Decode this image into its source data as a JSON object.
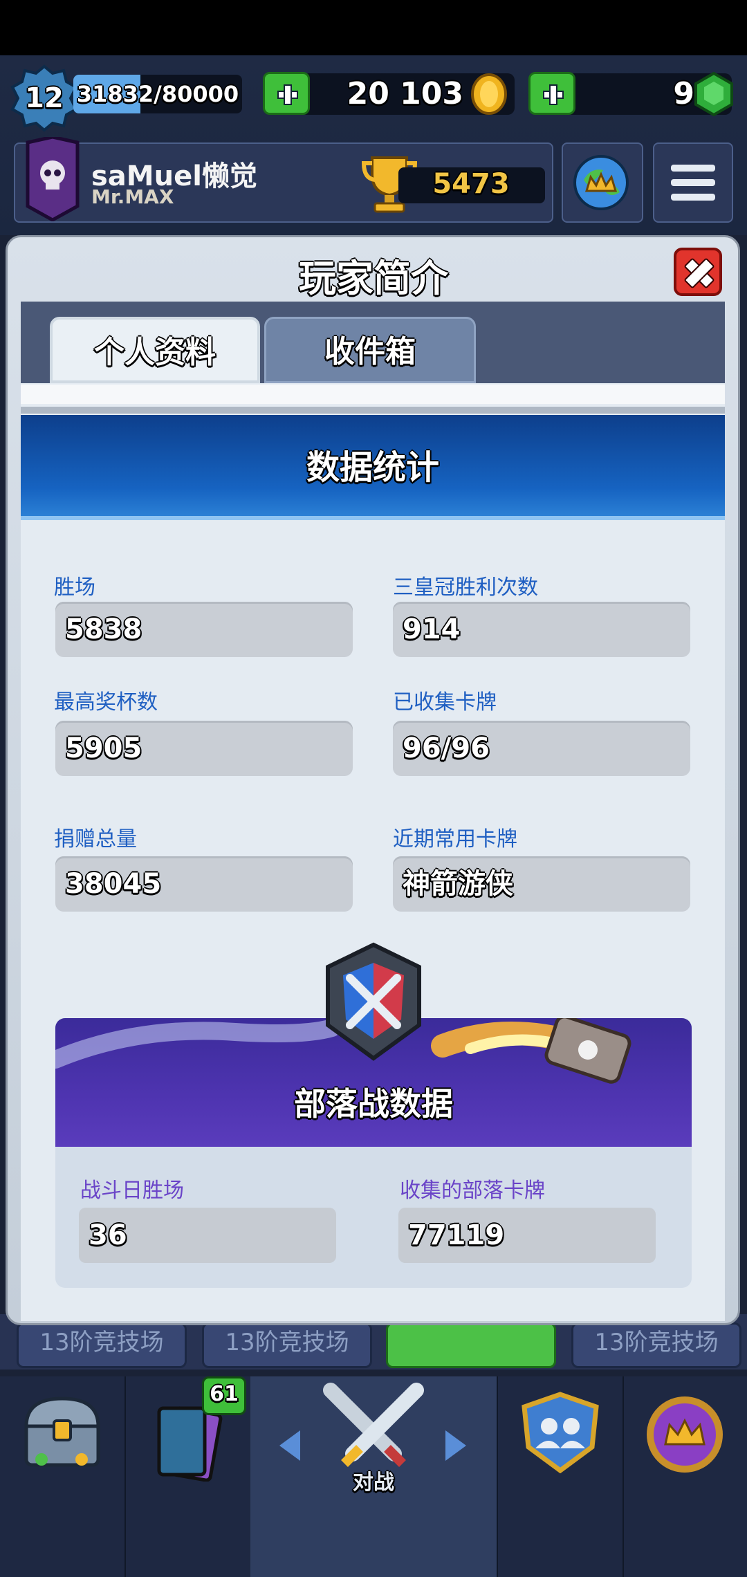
{
  "hud": {
    "level": "12",
    "xp": "31832/80000",
    "xp_fraction": 0.398,
    "gold": "20 103",
    "gems": "9",
    "player_name": "saMuel懒觉",
    "clan_name": "Mr.MAX",
    "trophies": "5473"
  },
  "modal": {
    "title": "玩家简介",
    "tabs": [
      "个人资料",
      "收件箱"
    ],
    "active_tab": "个人资料"
  },
  "stats": {
    "title": "数据统计",
    "items": [
      {
        "label": "胜场",
        "value": "5838"
      },
      {
        "label": "三皇冠胜利次数",
        "value": "914"
      },
      {
        "label": "最高奖杯数",
        "value": "5905"
      },
      {
        "label": "已收集卡牌",
        "value": "96/96"
      },
      {
        "label": "捐赠总量",
        "value": "38045"
      },
      {
        "label": "近期常用卡牌",
        "value": "神箭游侠"
      }
    ]
  },
  "clan_war": {
    "title": "部落战数据",
    "items": [
      {
        "label": "战斗日胜场",
        "value": "36"
      },
      {
        "label": "收集的部落卡牌",
        "value": "77119"
      }
    ]
  },
  "backdrop": {
    "arena_buttons": [
      "13阶竞技场",
      "13阶竞技场",
      "",
      "13阶竞技场"
    ],
    "battle_label": "对战",
    "cards_badge": "61"
  },
  "colors": {
    "accent_blue": "#1663c1",
    "clan_purple": "#4e34b0",
    "close_red": "#e1342c",
    "trophy_gold": "#f2c545"
  }
}
